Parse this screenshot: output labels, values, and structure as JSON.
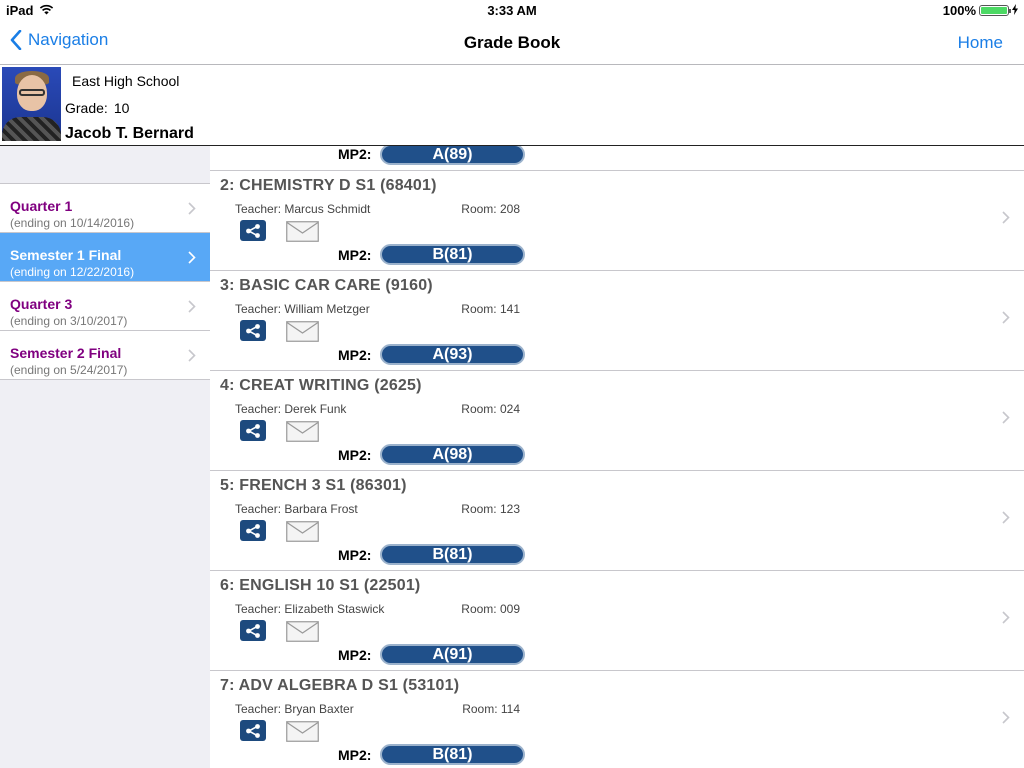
{
  "status_bar": {
    "device": "iPad",
    "time": "3:33 AM",
    "battery": "100%",
    "battery_level": 1.0
  },
  "nav": {
    "back_label": "Navigation",
    "title": "Grade Book",
    "home_label": "Home"
  },
  "student": {
    "school": "East High School",
    "grade_label": "Grade:",
    "grade_value": "10",
    "name": "Jacob T. Bernard"
  },
  "terms": [
    {
      "name": "Quarter 1",
      "ending": "(ending on 10/14/2016)",
      "selected": false
    },
    {
      "name": "Semester 1 Final",
      "ending": "(ending on 12/22/2016)",
      "selected": true
    },
    {
      "name": "Quarter 3",
      "ending": "(ending on 3/10/2017)",
      "selected": false
    },
    {
      "name": "Semester 2 Final",
      "ending": "(ending on 5/24/2017)",
      "selected": false
    }
  ],
  "top_partial": {
    "mp_label": "MP2:",
    "grade": "A(89)"
  },
  "courses": [
    {
      "title": "2: CHEMISTRY D S1 (68401)",
      "teacher": "Teacher: Marcus Schmidt",
      "room": "Room: 208",
      "mp_label": "MP2:",
      "grade": "B(81)"
    },
    {
      "title": "3: BASIC CAR CARE (9160)",
      "teacher": "Teacher: William Metzger",
      "room": "Room: 141",
      "mp_label": "MP2:",
      "grade": "A(93)"
    },
    {
      "title": "4: CREAT WRITING (2625)",
      "teacher": "Teacher: Derek Funk",
      "room": "Room: 024",
      "mp_label": "MP2:",
      "grade": "A(98)"
    },
    {
      "title": "5: FRENCH 3 S1 (86301)",
      "teacher": "Teacher: Barbara Frost",
      "room": "Room: 123",
      "mp_label": "MP2:",
      "grade": "B(81)"
    },
    {
      "title": "6: ENGLISH 10 S1 (22501)",
      "teacher": "Teacher: Elizabeth Staswick",
      "room": "Room: 009",
      "mp_label": "MP2:",
      "grade": "A(91)"
    },
    {
      "title": "7: ADV ALGEBRA D S1 (53101)",
      "teacher": "Teacher: Bryan Baxter",
      "room": "Room: 114",
      "mp_label": "MP2:",
      "grade": "B(81)"
    }
  ],
  "icons": {
    "back": "chevron-left-icon",
    "share": "share-icon",
    "mail": "envelope-icon",
    "disclosure": "chevron-right-icon",
    "wifi": "wifi-icon",
    "battery": "battery-icon",
    "charging": "bolt-icon"
  },
  "colors": {
    "accent": "#1a7ee6",
    "selected_row": "#58a8f6",
    "term_text": "#800080",
    "grade_pill": "#20508a",
    "battery_fill": "#4cd964"
  }
}
